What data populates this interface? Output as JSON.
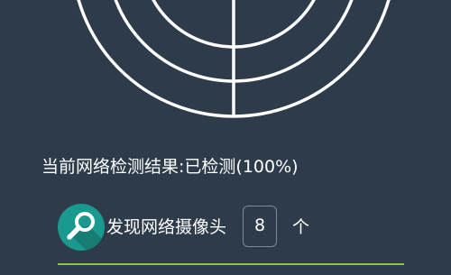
{
  "scan": {
    "status_prefix": "当前网络检测结果:",
    "status_value": "已检测(100%)",
    "progress_percent": 100
  },
  "result": {
    "found_label": "发现网络摄像头",
    "count": "8",
    "unit": "个"
  },
  "icons": {
    "radar": "radar-icon",
    "search": "magnifier-icon"
  },
  "colors": {
    "background": "#2d3b4a",
    "radar_stroke": "#ffffff",
    "badge": "#1a9a8e",
    "progress": "#8cc43c"
  }
}
